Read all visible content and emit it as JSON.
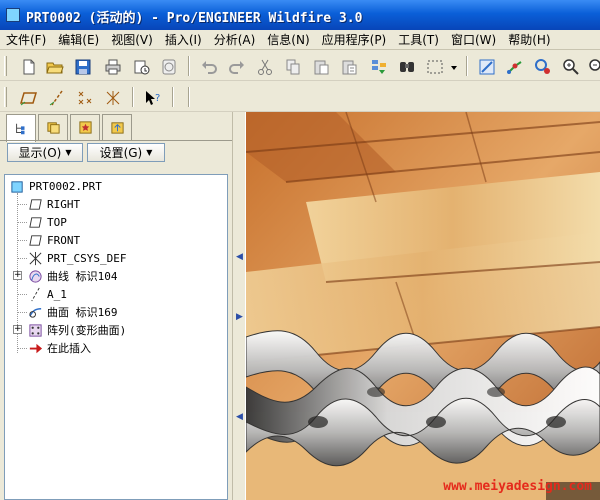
{
  "window": {
    "title": "PRT0002 (活动的) - Pro/ENGINEER Wildfire 3.0"
  },
  "menu": {
    "items": [
      {
        "label": "文件(F)"
      },
      {
        "label": "编辑(E)"
      },
      {
        "label": "视图(V)"
      },
      {
        "label": "插入(I)"
      },
      {
        "label": "分析(A)"
      },
      {
        "label": "信息(N)"
      },
      {
        "label": "应用程序(P)"
      },
      {
        "label": "工具(T)"
      },
      {
        "label": "窗口(W)"
      },
      {
        "label": "帮助(H)"
      }
    ]
  },
  "toolbar": {
    "row1_icons": [
      "new-icon",
      "open-icon",
      "save-icon",
      "print-icon",
      "send-mail-icon",
      "collaborate-icon",
      "undo-icon",
      "redo-icon",
      "cut-icon",
      "copy-icon",
      "paste-icon",
      "paste-special-icon",
      "regenerate-icon",
      "find-icon",
      "select-box-icon",
      "repaint-icon",
      "spin-center-icon",
      "orient-icon",
      "zoom-in-icon",
      "zoom-out-icon"
    ],
    "row2_icons": [
      "datum-plane-icon",
      "datum-axis-icon",
      "datum-point-icon",
      "csys-icon",
      "whats-this-icon"
    ]
  },
  "left_panel": {
    "tabs": [
      "model-tree-tab",
      "layer-tab",
      "favorites-tab",
      "folder-tab"
    ],
    "show_button": "显示(O)",
    "settings_button": "设置(G)",
    "tree": {
      "root": "PRT0002.PRT",
      "items": [
        {
          "label": "RIGHT",
          "icon": "datum-plane-icon",
          "expandable": false
        },
        {
          "label": "TOP",
          "icon": "datum-plane-icon",
          "expandable": false
        },
        {
          "label": "FRONT",
          "icon": "datum-plane-icon",
          "expandable": false
        },
        {
          "label": "PRT_CSYS_DEF",
          "icon": "csys-icon",
          "expandable": false
        },
        {
          "label": "曲线 标识104",
          "icon": "curve-icon",
          "expandable": true
        },
        {
          "label": "A_1",
          "icon": "axis-icon",
          "expandable": false
        },
        {
          "label": "曲面 标识169",
          "icon": "surface-icon",
          "expandable": false
        },
        {
          "label": "阵列(变形曲面)",
          "icon": "pattern-icon",
          "expandable": true
        },
        {
          "label": "在此插入",
          "icon": "insert-here-arrow-icon",
          "expandable": false
        }
      ]
    }
  },
  "viewport": {
    "watermark": "www.meiyadesign.com"
  }
}
